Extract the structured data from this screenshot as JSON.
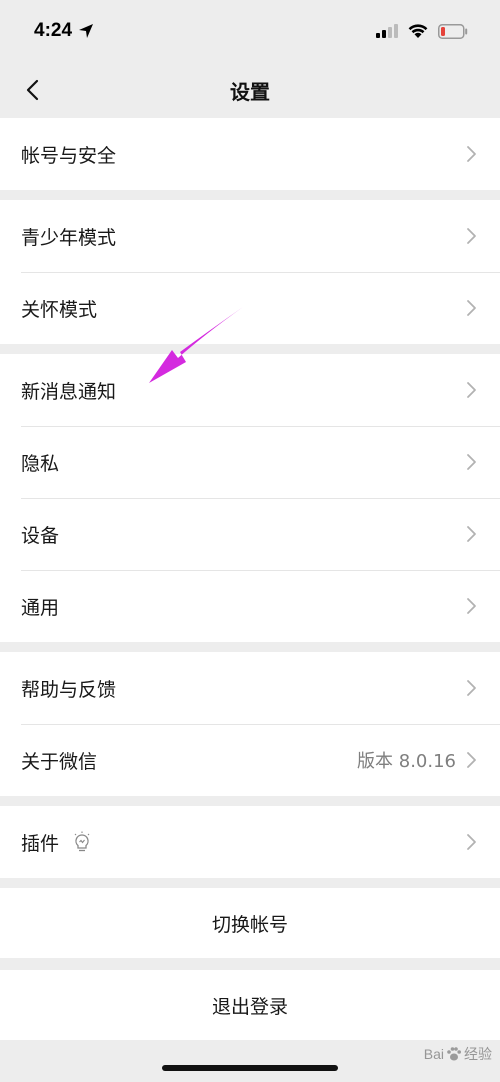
{
  "status_bar": {
    "time": "4:24",
    "icons": [
      "location-arrow-icon",
      "signal-icon",
      "wifi-icon",
      "battery-low-icon"
    ],
    "battery_color": "#e5423a"
  },
  "nav": {
    "title": "设置",
    "back_icon": "chevron-left-icon"
  },
  "groups": [
    {
      "items": [
        {
          "label": "帐号与安全"
        }
      ]
    },
    {
      "items": [
        {
          "label": "青少年模式"
        },
        {
          "label": "关怀模式"
        }
      ]
    },
    {
      "items": [
        {
          "label": "新消息通知"
        },
        {
          "label": "隐私"
        },
        {
          "label": "设备"
        },
        {
          "label": "通用"
        }
      ]
    },
    {
      "items": [
        {
          "label": "帮助与反馈"
        },
        {
          "label": "关于微信",
          "value": "版本 8.0.16"
        }
      ]
    },
    {
      "items": [
        {
          "label": "插件",
          "icon": "lightbulb-icon"
        }
      ]
    }
  ],
  "actions": {
    "switch_account": "切换帐号",
    "logout": "退出登录"
  },
  "annotation": {
    "arrow_color": "#d42adf",
    "points_to": "新消息通知"
  },
  "watermark": {
    "text_left": "Bai",
    "text_right": "经验"
  },
  "colors": {
    "background": "#ededed",
    "cell": "#ffffff",
    "separator": "#e5e5e5",
    "secondary_text": "#7f7f7f"
  }
}
